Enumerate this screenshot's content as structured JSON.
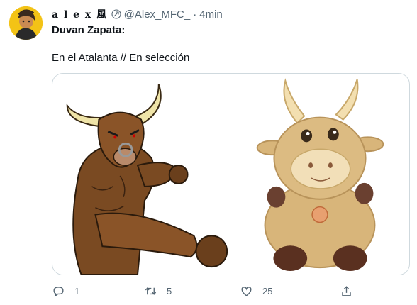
{
  "author": {
    "display_name": "a l e x 風",
    "handle": "@Alex_MFC_",
    "separator": "·",
    "time": "4min"
  },
  "tweet": {
    "line1": "Duvan Zapata:",
    "line2": "En el Atalanta // En selección"
  },
  "media": {
    "left_image": "muscular-cartoon-bull",
    "right_image": "plush-toy-bull"
  },
  "actions": {
    "reply_count": "1",
    "retweet_count": "5",
    "like_count": "25"
  },
  "colors": {
    "secondary_text": "#536471",
    "border": "#cfd9de",
    "avatar_bg": "#f3c316"
  }
}
